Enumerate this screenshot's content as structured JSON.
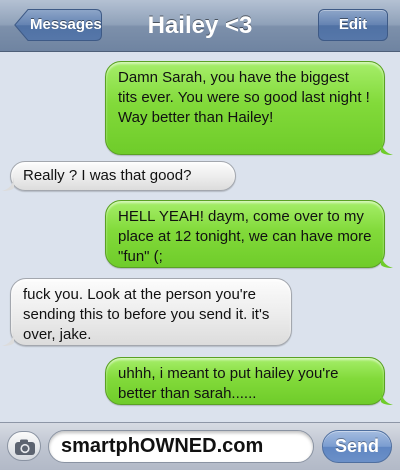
{
  "header": {
    "back_label": "Messages",
    "title": "Hailey <3",
    "edit_label": "Edit"
  },
  "messages": [
    {
      "direction": "sent",
      "text": "Damn Sarah, you have the biggest tits ever. You were so good last night ! Way better than Hailey!"
    },
    {
      "direction": "received",
      "text": "Really ? I was that good?"
    },
    {
      "direction": "sent",
      "text": "HELL YEAH! daym, come over to my place at 12 tonight, we can have more \"fun\" (;"
    },
    {
      "direction": "received",
      "text": "fuck you. Look at the person you're sending this to before you send it. it's over, jake."
    },
    {
      "direction": "sent",
      "text": "uhhh, i meant to put hailey you're better than sarah......"
    }
  ],
  "compose": {
    "value": "smartphOWNED.com",
    "send_label": "Send",
    "camera_icon": "camera-icon"
  },
  "colors": {
    "sent_bubble": "#82da3a",
    "received_bubble": "#ececec",
    "background": "#dbe2ed",
    "navbar": "#8fa1b9"
  }
}
